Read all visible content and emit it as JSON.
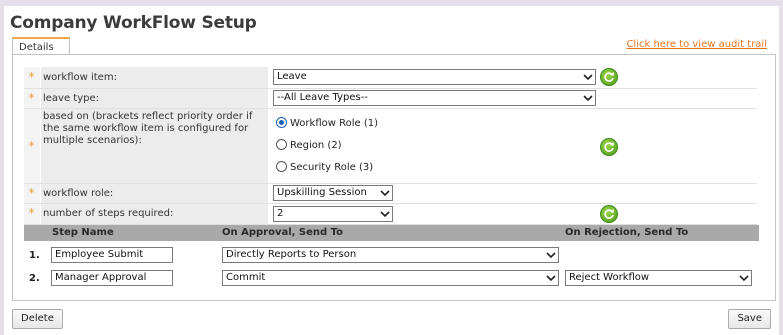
{
  "title": "Company WorkFlow Setup",
  "tab_details": "Details",
  "audit_link": "Click here to view audit trail",
  "form": {
    "workflow_item": {
      "label": "workflow item:",
      "value": "Leave"
    },
    "leave_type": {
      "label": "leave type:",
      "value": "--All Leave Types--"
    },
    "based_on": {
      "label": "based on (brackets reflect priority order if the same workflow item is configured for multiple scenarios):",
      "options": [
        {
          "label": "Workflow Role (1)",
          "selected": true
        },
        {
          "label": "Region (2)",
          "selected": false
        },
        {
          "label": "Security Role (3)",
          "selected": false
        }
      ]
    },
    "workflow_role": {
      "label": "workflow role:",
      "value": "Upskilling Session"
    },
    "steps_required": {
      "label": "number of steps required:",
      "value": "2"
    },
    "required_marker": "*"
  },
  "steps": {
    "headers": [
      "Step Name",
      "On Approval, Send To",
      "On Rejection, Send To"
    ],
    "rows": [
      {
        "num": "1.",
        "name": "Employee Submit",
        "approval": "Directly Reports to Person",
        "rejection": ""
      },
      {
        "num": "2.",
        "name": "Manager Approval",
        "approval": "Commit",
        "rejection": "Reject Workflow"
      }
    ]
  },
  "buttons": {
    "delete": "Delete",
    "save": "Save"
  },
  "icons": {
    "refresh": "refresh-icon",
    "dropdown": "chevron-down-icon"
  },
  "colors": {
    "accent": "#e8731c",
    "required": "#e8a236",
    "refresh": "#5aa824",
    "header_bg": "#a9a9a9"
  }
}
